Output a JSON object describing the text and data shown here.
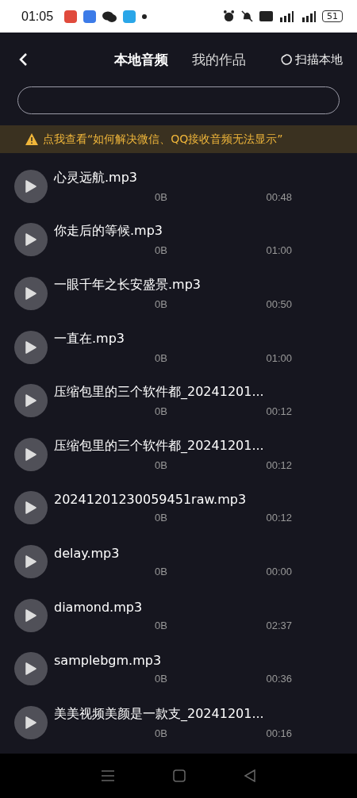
{
  "status_bar": {
    "time": "01:05",
    "battery": "51"
  },
  "header": {
    "tabs": [
      {
        "label": "本地音频",
        "selected": true
      },
      {
        "label": "我的作品",
        "selected": false
      }
    ],
    "scan_label": "扫描本地"
  },
  "notice": "点我查看“如何解决微信、QQ接收音频无法显示”",
  "tracks": [
    {
      "name": "心灵远航.mp3",
      "size": "0B",
      "duration": "00:48"
    },
    {
      "name": "你走后的等候.mp3",
      "size": "0B",
      "duration": "01:00"
    },
    {
      "name": "一眼千年之长安盛景.mp3",
      "size": "0B",
      "duration": "00:50"
    },
    {
      "name": "一直在.mp3",
      "size": "0B",
      "duration": "01:00"
    },
    {
      "name": "压缩包里的三个软件都_20241201...",
      "size": "0B",
      "duration": "00:12"
    },
    {
      "name": "压缩包里的三个软件都_20241201...",
      "size": "0B",
      "duration": "00:12"
    },
    {
      "name": "20241201230059451raw.mp3",
      "size": "0B",
      "duration": "00:12"
    },
    {
      "name": "delay.mp3",
      "size": "0B",
      "duration": "00:00"
    },
    {
      "name": "diamond.mp3",
      "size": "0B",
      "duration": "02:37"
    },
    {
      "name": "samplebgm.mp3",
      "size": "0B",
      "duration": "00:36"
    },
    {
      "name": "美美视频美颜是一款支_20241201...",
      "size": "0B",
      "duration": "00:16"
    }
  ]
}
